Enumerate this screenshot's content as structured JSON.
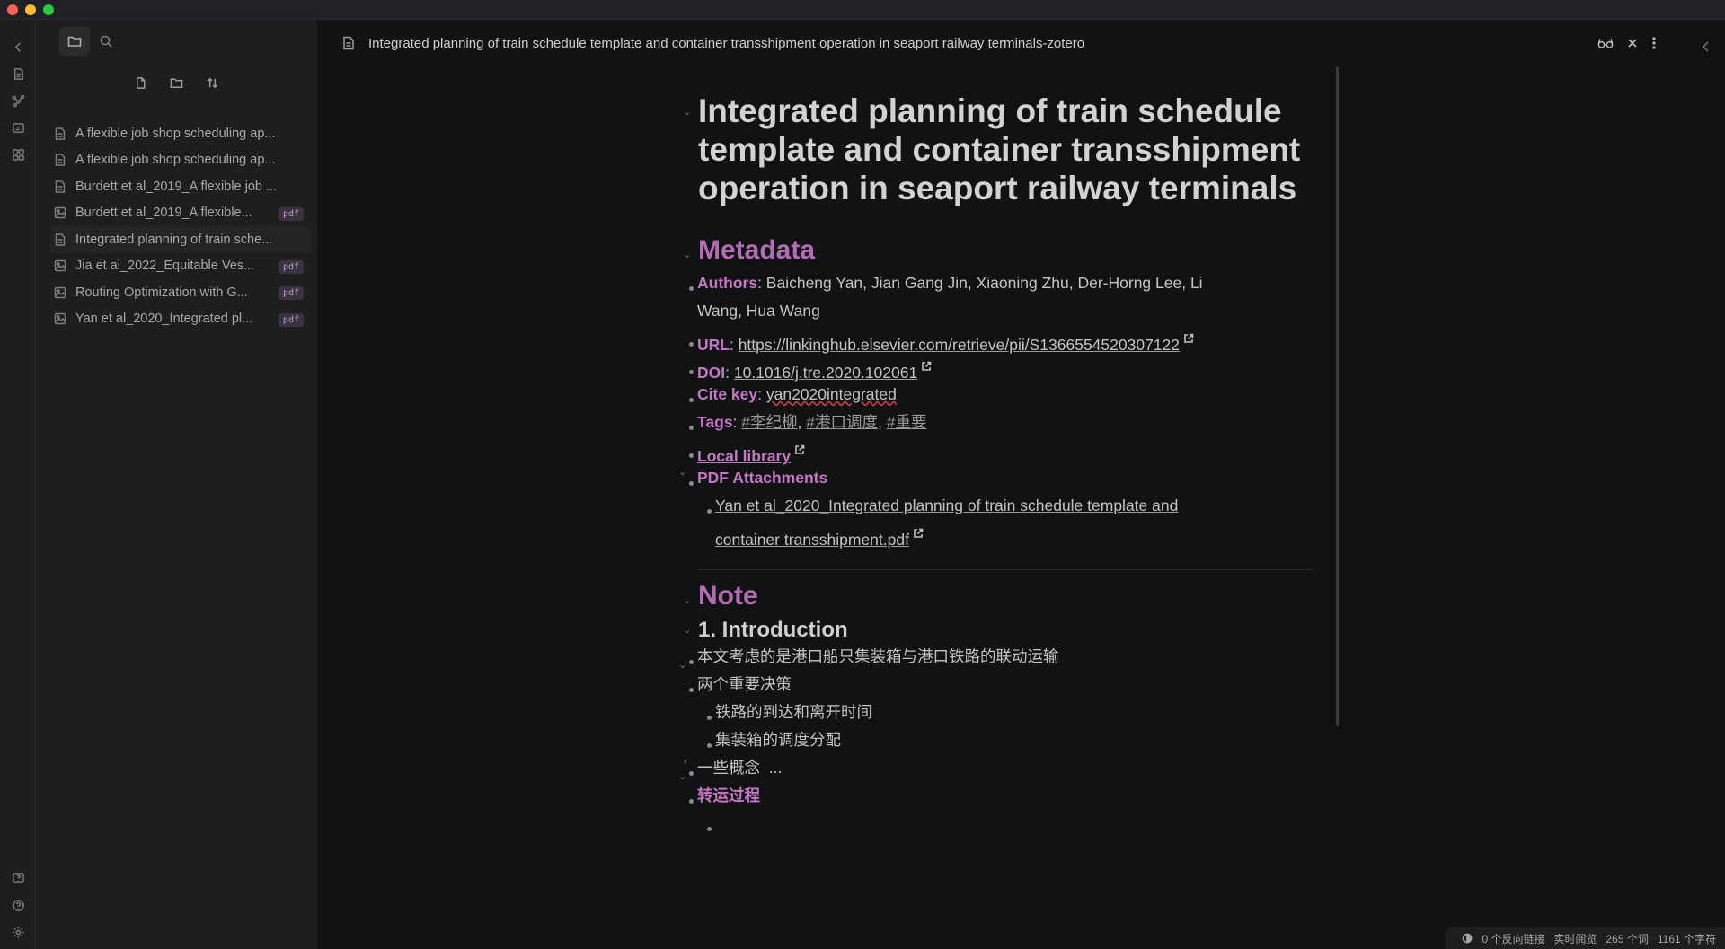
{
  "window": {
    "tab_title": "Integrated planning of train schedule template and container transshipment operation in seaport railway terminals-zotero"
  },
  "sidebar": {
    "files": [
      {
        "name": "A flexible job shop scheduling ap...",
        "type": "note",
        "badge": ""
      },
      {
        "name": "A flexible job shop scheduling ap...",
        "type": "note",
        "badge": ""
      },
      {
        "name": "Burdett et al_2019_A flexible job ...",
        "type": "note",
        "badge": ""
      },
      {
        "name": "Burdett et al_2019_A flexible...",
        "type": "pdf",
        "badge": "pdf"
      },
      {
        "name": "Integrated planning of train sche...",
        "type": "note",
        "badge": ""
      },
      {
        "name": "Jia et al_2022_Equitable Ves...",
        "type": "pdf",
        "badge": "pdf"
      },
      {
        "name": "Routing Optimization with G...",
        "type": "pdf",
        "badge": "pdf"
      },
      {
        "name": "Yan et al_2020_Integrated pl...",
        "type": "pdf",
        "badge": "pdf"
      }
    ]
  },
  "doc": {
    "title": "Integrated planning of train schedule template and container transshipment operation in seaport railway terminals",
    "metadata_heading": "Metadata",
    "authors_key": "Authors",
    "authors_line1": ": Baicheng Yan,  Jian Gang Jin,  Xiaoning Zhu,  Der-Horng Lee,  Li",
    "authors_line2": "Wang,  Hua Wang",
    "url_key": "URL",
    "url_value": "https://linkinghub.elsevier.com/retrieve/pii/S1366554520307122",
    "doi_key": "DOI",
    "doi_value": "10.1016/j.tre.2020.102061",
    "citekey_key": "Cite key",
    "citekey_value": "yan2020integrated",
    "tags_key": "Tags",
    "tag1": "#李纪柳",
    "tag2": "#港口调度",
    "tag3": "#重要",
    "local_library": "Local library",
    "pdf_attachments": "PDF Attachments",
    "pdf_line1": "Yan et al_2020_Integrated planning of train schedule template and ",
    "pdf_line2": "container transshipment.pdf",
    "note_heading": "Note",
    "intro_heading": "1. Introduction",
    "item1": "本文考虑的是港口船只集装箱与港口铁路的联动运输",
    "item2": "两个重要决策",
    "item2a": "铁路的到达和离开时间",
    "item2b": "集装箱的调度分配",
    "item3": "一些概念",
    "item3_ellipsis": "...",
    "item4": "转运过程"
  },
  "status": {
    "backlinks": "0 个反向链接",
    "mode": "实时阅览",
    "words": "265 个词",
    "chars": "1161 个字符"
  },
  "colors": {
    "accent": "#b36bb5",
    "background": "#111214",
    "sidebar": "#1e1e1e"
  }
}
